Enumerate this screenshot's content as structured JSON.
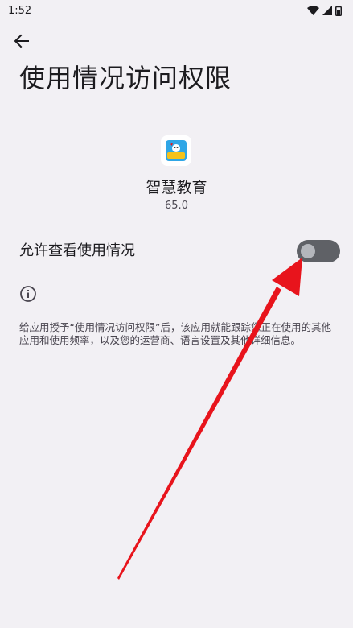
{
  "status_bar": {
    "time": "1:52",
    "icons": [
      "wifi-icon",
      "signal-icon",
      "battery-icon"
    ]
  },
  "header": {
    "back_icon": "arrow-left-icon",
    "title": "使用情况访问权限"
  },
  "app": {
    "icon": "app-icon",
    "name": "智慧教育",
    "version": "65.0"
  },
  "permission": {
    "label": "允许查看使用情况",
    "enabled": false
  },
  "info": {
    "icon": "info-icon",
    "text": "给应用授予“使用情况访问权限”后，该应用就能跟踪您正在使用的其他应用和使用频率，以及您的运营商、语言设置及其他详细信息。"
  },
  "annotation": {
    "arrow_color": "#e8141c"
  },
  "colors": {
    "background": "#f2f0f4",
    "switch_track": "#5f6166",
    "switch_thumb": "#b4b6bb"
  }
}
